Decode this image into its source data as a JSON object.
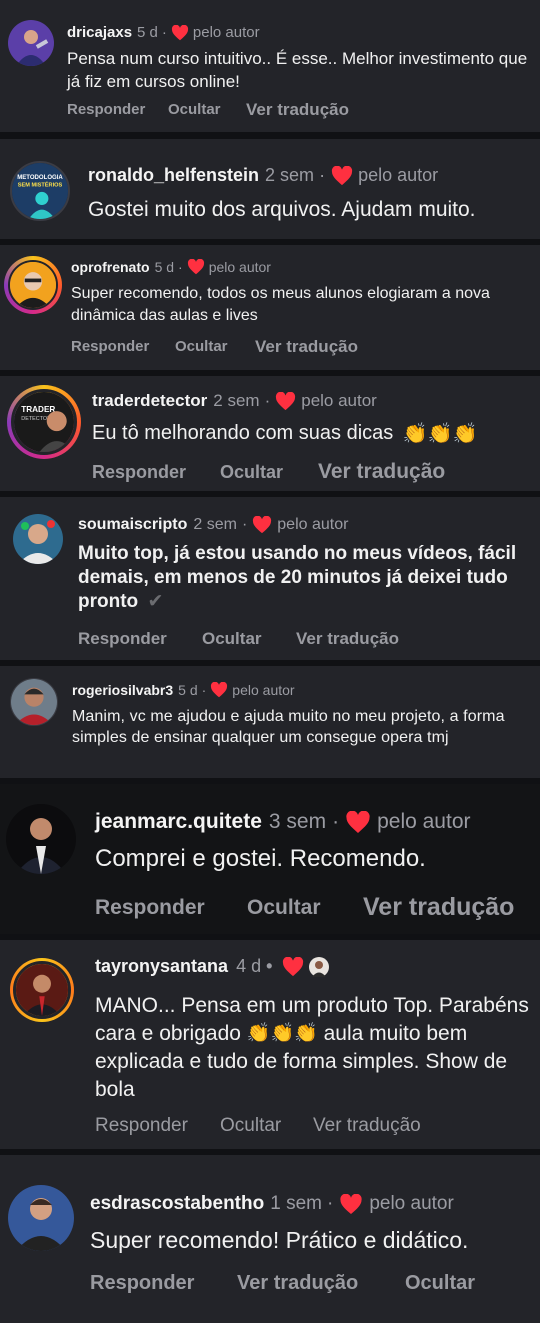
{
  "comments": [
    {
      "user": "dricajaxs",
      "time": "5 d",
      "liked": "pelo autor",
      "text": "Pensa num curso intuitivo.. É esse.. Melhor investimento que já fiz em cursos online!",
      "actions": [
        "Responder",
        "Ocultar",
        "Ver tradução"
      ]
    },
    {
      "user": "ronaldo_helfenstein",
      "time": "2 sem",
      "liked": "pelo autor",
      "text": "Gostei muito dos arquivos. Ajudam muito.",
      "avatar_text": "METODOLOGIA SEM MISTÉRIOS"
    },
    {
      "user": "oprofrenato",
      "time": "5 d",
      "liked": "pelo autor",
      "text": "Super recomendo, todos os meus alunos elogiaram a nova dinâmica das aulas e lives",
      "actions": [
        "Responder",
        "Ocultar",
        "Ver tradução"
      ]
    },
    {
      "user": "traderdetector",
      "time": "2 sem",
      "liked": "pelo autor",
      "text": "Eu tô melhorando com suas dicas",
      "emoji": "👏👏👏",
      "actions": [
        "Responder",
        "Ocultar",
        "Ver tradução"
      ],
      "avatar_text": "TRADER DETECTOR"
    },
    {
      "user": "soumaiscripto",
      "time": "2 sem",
      "liked": "pelo autor",
      "text": "Muito top, já estou usando no meus vídeos, fácil demais, em menos de 20 minutos já deixei tudo pronto",
      "emoji": "✔",
      "actions": [
        "Responder",
        "Ocultar",
        "Ver tradução"
      ]
    },
    {
      "user": "rogeriosilvabr3",
      "time": "5 d",
      "liked": "pelo autor",
      "text": "Manim, vc me ajudou e ajuda muito no meu projeto, a forma simples de ensinar qualquer um consegue opera tmj"
    },
    {
      "user": "jeanmarc.quitete",
      "time": "3 sem",
      "liked": "pelo autor",
      "text": "Comprei e gostei. Recomendo.",
      "actions": [
        "Responder",
        "Ocultar",
        "Ver tradução"
      ]
    },
    {
      "user": "tayronysantana",
      "time": "4 d",
      "text_a": "MANO... Pensa em um produto Top. Parabéns cara e obrigado",
      "emoji": "👏👏👏",
      "text_b": "aula muito bem explicada e tudo de forma simples. Show de bola",
      "actions": [
        "Responder",
        "Ocultar",
        "Ver tradução"
      ]
    },
    {
      "user": "esdrascostabentho",
      "time": "1 sem",
      "liked": "pelo autor",
      "text": "Super recomendo! Prático e didático.",
      "actions": [
        "Responder",
        "Ver tradução",
        "Ocultar"
      ]
    }
  ],
  "colors": {
    "heart": "#ff3040",
    "card": "#232429",
    "card_dark": "#131416",
    "muted": "#9b9ca3"
  }
}
